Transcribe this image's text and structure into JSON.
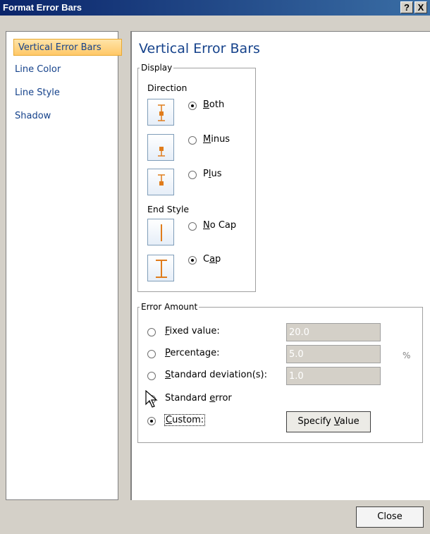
{
  "window": {
    "title": "Format Error Bars",
    "help_label": "?",
    "close_label": "X"
  },
  "sidebar": {
    "items": [
      {
        "label": "Vertical Error Bars",
        "active": true
      },
      {
        "label": "Line Color",
        "active": false
      },
      {
        "label": "Line Style",
        "active": false
      },
      {
        "label": "Shadow",
        "active": false
      }
    ]
  },
  "main": {
    "title": "Vertical Error Bars",
    "display": {
      "legend": "Display",
      "direction_label": "Direction",
      "options": {
        "both": {
          "pre": "",
          "key": "B",
          "post": "oth",
          "checked": true
        },
        "minus": {
          "pre": "",
          "key": "M",
          "post": "inus",
          "checked": false
        },
        "plus": {
          "pre": "P",
          "key": "l",
          "post": "us",
          "checked": false
        }
      },
      "end_style_label": "End Style",
      "end_options": {
        "nocap": {
          "pre": "",
          "key": "N",
          "post": "o Cap",
          "checked": false
        },
        "cap": {
          "pre": "C",
          "key": "a",
          "post": "p",
          "checked": true
        }
      }
    },
    "error_amount": {
      "legend": "Error Amount",
      "fixed": {
        "pre": "",
        "key": "F",
        "post": "ixed value:",
        "value": "20.0",
        "checked": false
      },
      "percentage": {
        "pre": "",
        "key": "P",
        "post": "ercentage:",
        "value": "5.0",
        "unit": "%",
        "checked": false
      },
      "stddev": {
        "pre": "",
        "key": "S",
        "post": "tandard deviation(s):",
        "value": "1.0",
        "checked": false
      },
      "stderr": {
        "pre": "Standard ",
        "key": "e",
        "post": "rror",
        "checked": false
      },
      "custom": {
        "pre": "",
        "key": "C",
        "post": "ustom:",
        "checked": true
      },
      "specify": {
        "pre": "Specify ",
        "key": "V",
        "post": "alue"
      }
    }
  },
  "footer": {
    "close_label": "Close"
  },
  "colors": {
    "accent": "#e07c1c",
    "title_blue": "#15428b",
    "titlebar": "#0a246a"
  }
}
